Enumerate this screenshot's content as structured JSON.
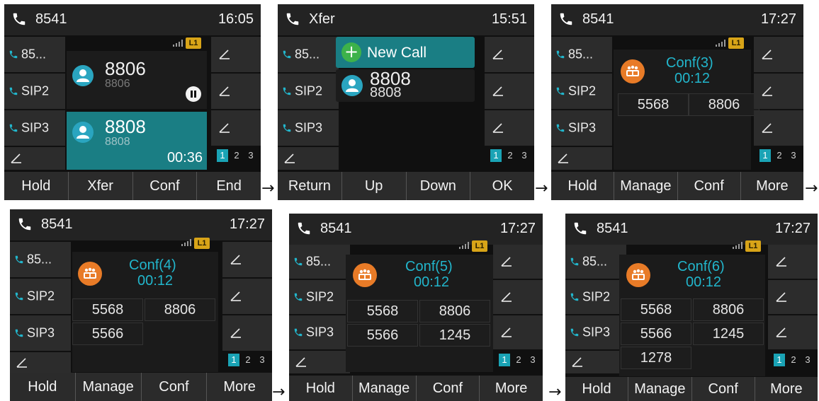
{
  "colors": {
    "accent": "#1aa3b5",
    "conf_orange": "#e87b27",
    "line_badge": "#d8a418",
    "call_active": "#1a7e84"
  },
  "screens": [
    {
      "title": "8541",
      "time": "16:05",
      "line_keys": [
        "85...",
        "SIP2",
        "SIP3"
      ],
      "line_badge": "L1",
      "calls": [
        {
          "name": "8806",
          "number": "8806",
          "status_icon": "pause-icon"
        },
        {
          "name": "8808",
          "number": "8808",
          "duration": "00:36"
        }
      ],
      "pages": [
        "1",
        "2",
        "3"
      ],
      "softkeys": [
        "Hold",
        "Xfer",
        "Conf",
        "End"
      ]
    },
    {
      "title": "Xfer",
      "time": "15:51",
      "line_keys": [
        "85...",
        "SIP2",
        "SIP3"
      ],
      "new_call": "New Call",
      "call": {
        "name": "8808",
        "number": "8808"
      },
      "pages": [
        "1",
        "2",
        "3"
      ],
      "softkeys": [
        "Return",
        "Up",
        "Down",
        "OK"
      ]
    },
    {
      "title": "8541",
      "time": "17:27",
      "line_keys": [
        "85...",
        "SIP2",
        "SIP3"
      ],
      "line_badge": "L1",
      "conf_title": "Conf(3)",
      "conf_time": "00:12",
      "members": [
        "5568",
        "8806"
      ],
      "pages": [
        "1",
        "2",
        "3"
      ],
      "softkeys": [
        "Hold",
        "Manage",
        "Conf",
        "More"
      ]
    },
    {
      "title": "8541",
      "time": "17:27",
      "line_keys": [
        "85...",
        "SIP2",
        "SIP3"
      ],
      "line_badge": "L1",
      "conf_title": "Conf(4)",
      "conf_time": "00:12",
      "members": [
        "5568",
        "8806",
        "5566"
      ],
      "pages": [
        "1",
        "2",
        "3"
      ],
      "softkeys": [
        "Hold",
        "Manage",
        "Conf",
        "More"
      ]
    },
    {
      "title": "8541",
      "time": "17:27",
      "line_keys": [
        "85...",
        "SIP2",
        "SIP3"
      ],
      "line_badge": "L1",
      "conf_title": "Conf(5)",
      "conf_time": "00:12",
      "members": [
        "5568",
        "8806",
        "5566",
        "1245"
      ],
      "pages": [
        "1",
        "2",
        "3"
      ],
      "softkeys": [
        "Hold",
        "Manage",
        "Conf",
        "More"
      ]
    },
    {
      "title": "8541",
      "time": "17:27",
      "line_keys": [
        "85...",
        "SIP2",
        "SIP3"
      ],
      "line_badge": "L1",
      "conf_title": "Conf(6)",
      "conf_time": "00:12",
      "members": [
        "5568",
        "8806",
        "5566",
        "1245",
        "1278"
      ],
      "pages": [
        "1",
        "2",
        "3"
      ],
      "softkeys": [
        "Hold",
        "Manage",
        "Conf",
        "More"
      ]
    }
  ]
}
